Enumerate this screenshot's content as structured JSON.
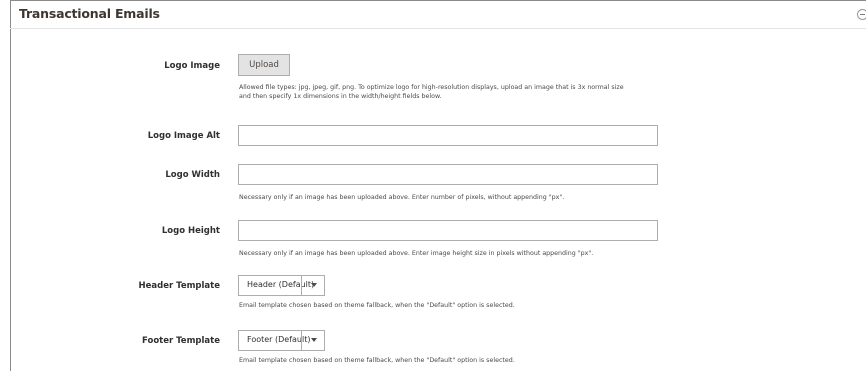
{
  "section": {
    "title": "Transactional Emails",
    "collapse_icon": "collapse-circle-icon"
  },
  "logo_image": {
    "label": "Logo Image",
    "button_label": "Upload",
    "note_line1": "Allowed file types: jpg, jpeg, gif, png. To optimize logo for high-resolution displays, upload an image that is 3x normal size",
    "note_line2": "and then specify 1x dimensions in the width/height fields below."
  },
  "logo_image_alt": {
    "label": "Logo Image Alt",
    "value": ""
  },
  "logo_width": {
    "label": "Logo Width",
    "value": "",
    "note": "Necessary only if an image has been uploaded above. Enter number of pixels, without appending \"px\"."
  },
  "logo_height": {
    "label": "Logo Height",
    "value": "",
    "note": "Necessary only if an image has been uploaded above. Enter image height size in pixels without appending \"px\"."
  },
  "header_template": {
    "label": "Header Template",
    "selected": "Header (Default)",
    "note": "Email template chosen based on theme fallback, when the \"Default\" option is selected."
  },
  "footer_template": {
    "label": "Footer Template",
    "selected": "Footer (Default)",
    "note": "Email template chosen based on theme fallback, when the \"Default\" option is selected."
  }
}
